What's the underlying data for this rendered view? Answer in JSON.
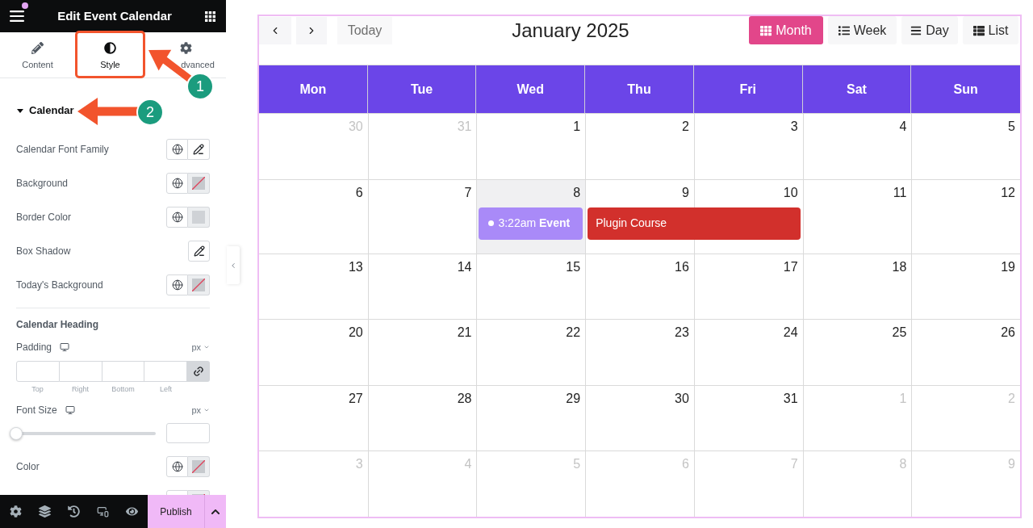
{
  "panel": {
    "title": "Edit Event Calendar",
    "tabs": [
      {
        "label": "Content",
        "selected": false
      },
      {
        "label": "Style",
        "selected": true
      },
      {
        "label": "dvanced",
        "selected": false
      }
    ],
    "section": {
      "title": "Calendar",
      "expanded": true
    },
    "controls": [
      {
        "kind": "font",
        "label": "Calendar Font Family"
      },
      {
        "kind": "color",
        "label": "Background",
        "empty": true
      },
      {
        "kind": "color",
        "label": "Border Color",
        "empty": false,
        "color": "#cfd2d6"
      },
      {
        "kind": "shadow",
        "label": "Box Shadow"
      },
      {
        "kind": "color",
        "label": "Today's Background",
        "empty": true
      }
    ],
    "subsection": {
      "title": "Calendar Heading",
      "controls": [
        {
          "kind": "dimensions",
          "label": "Padding",
          "unit": "px",
          "fields": [
            "Top",
            "Right",
            "Bottom",
            "Left"
          ]
        },
        {
          "kind": "slider",
          "label": "Font Size",
          "unit": "px",
          "level": 0
        },
        {
          "kind": "color",
          "label": "Color",
          "empty": true
        },
        {
          "kind": "color",
          "empty": true
        }
      ]
    },
    "footer": {
      "publish": "Publish"
    }
  },
  "calendar": {
    "today_button": "Today",
    "title": "January 2025",
    "views": [
      {
        "label": "Month",
        "selected": true
      },
      {
        "label": "Week",
        "selected": false
      },
      {
        "label": "Day",
        "selected": false
      },
      {
        "label": "List",
        "selected": false
      }
    ],
    "weekdays": [
      "Mon",
      "Tue",
      "Wed",
      "Thu",
      "Fri",
      "Sat",
      "Sun"
    ],
    "weeks": [
      {
        "days": [
          {
            "date": "30",
            "other_month": true,
            "today": false
          },
          {
            "date": "31",
            "other_month": true,
            "today": false
          },
          {
            "date": "1",
            "other_month": false,
            "today": false
          },
          {
            "date": "2",
            "other_month": false,
            "today": false
          },
          {
            "date": "3",
            "other_month": false,
            "today": false
          },
          {
            "date": "4",
            "other_month": false,
            "today": false
          },
          {
            "date": "5",
            "other_month": false,
            "today": false
          }
        ]
      },
      {
        "days": [
          {
            "date": "6",
            "other_month": false,
            "today": false
          },
          {
            "date": "7",
            "other_month": false,
            "today": false
          },
          {
            "date": "8",
            "other_month": false,
            "today": true,
            "events": [
              {
                "kind": "timed",
                "time": "3:22am",
                "title": "Event",
                "color": "#a98af8",
                "continues": false
              }
            ]
          },
          {
            "date": "9",
            "other_month": false,
            "today": false,
            "events": [
              {
                "kind": "all_day",
                "title": "Plugin Course",
                "color": "#d2302c",
                "continues": true
              }
            ]
          },
          {
            "date": "10",
            "other_month": false,
            "today": false
          },
          {
            "date": "11",
            "other_month": false,
            "today": false
          },
          {
            "date": "12",
            "other_month": false,
            "today": false
          }
        ]
      },
      {
        "days": [
          {
            "date": "13",
            "other_month": false,
            "today": false
          },
          {
            "date": "14",
            "other_month": false,
            "today": false
          },
          {
            "date": "15",
            "other_month": false,
            "today": false
          },
          {
            "date": "16",
            "other_month": false,
            "today": false
          },
          {
            "date": "17",
            "other_month": false,
            "today": false
          },
          {
            "date": "18",
            "other_month": false,
            "today": false
          },
          {
            "date": "19",
            "other_month": false,
            "today": false
          }
        ]
      },
      {
        "days": [
          {
            "date": "20",
            "other_month": false,
            "today": false
          },
          {
            "date": "21",
            "other_month": false,
            "today": false
          },
          {
            "date": "22",
            "other_month": false,
            "today": false
          },
          {
            "date": "23",
            "other_month": false,
            "today": false
          },
          {
            "date": "24",
            "other_month": false,
            "today": false
          },
          {
            "date": "25",
            "other_month": false,
            "today": false
          },
          {
            "date": "26",
            "other_month": false,
            "today": false
          }
        ]
      },
      {
        "days": [
          {
            "date": "27",
            "other_month": false,
            "today": false
          },
          {
            "date": "28",
            "other_month": false,
            "today": false
          },
          {
            "date": "29",
            "other_month": false,
            "today": false
          },
          {
            "date": "30",
            "other_month": false,
            "today": false
          },
          {
            "date": "31",
            "other_month": false,
            "today": false
          },
          {
            "date": "1",
            "other_month": true,
            "today": false
          },
          {
            "date": "2",
            "other_month": true,
            "today": false
          }
        ]
      },
      {
        "days": [
          {
            "date": "3",
            "other_month": true,
            "today": false
          },
          {
            "date": "4",
            "other_month": true,
            "today": false
          },
          {
            "date": "5",
            "other_month": true,
            "today": false
          },
          {
            "date": "6",
            "other_month": true,
            "today": false
          },
          {
            "date": "7",
            "other_month": true,
            "today": false
          },
          {
            "date": "8",
            "other_month": true,
            "today": false
          },
          {
            "date": "9",
            "other_month": true,
            "today": false
          }
        ]
      }
    ]
  },
  "annotations": {
    "markers": [
      {
        "label": "1"
      },
      {
        "label": "2"
      }
    ]
  }
}
